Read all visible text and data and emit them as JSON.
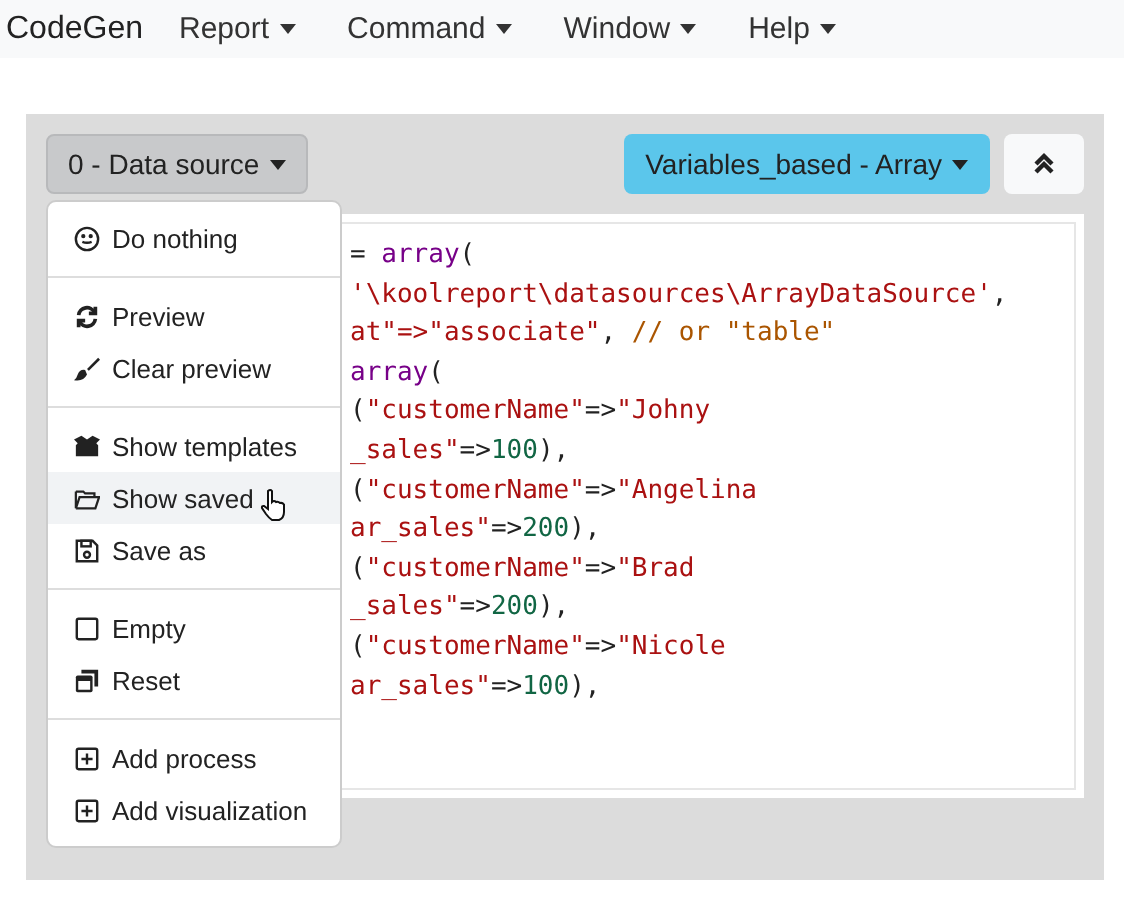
{
  "navbar": {
    "brand": "CodeGen",
    "menus": [
      {
        "label": "Report"
      },
      {
        "label": "Command"
      },
      {
        "label": "Window"
      },
      {
        "label": "Help"
      }
    ]
  },
  "toolbar": {
    "datasource_button": "0 - Data source",
    "variables_button": "Variables_based - Array",
    "collapse_button": {
      "expanded": true
    }
  },
  "menu": {
    "sections": [
      {
        "items": [
          {
            "label": "Do nothing",
            "hovered": false
          }
        ]
      },
      {
        "items": [
          {
            "label": "Preview",
            "hovered": false
          },
          {
            "label": "Clear preview",
            "hovered": false
          }
        ]
      },
      {
        "items": [
          {
            "label": "Show templates",
            "hovered": false
          },
          {
            "label": "Show saved",
            "hovered": true
          },
          {
            "label": "Save as",
            "hovered": false
          }
        ]
      },
      {
        "items": [
          {
            "label": "Empty",
            "hovered": false
          },
          {
            "label": "Reset",
            "hovered": false
          }
        ]
      },
      {
        "items": [
          {
            "label": "Add process",
            "hovered": false
          },
          {
            "label": "Add visualization",
            "hovered": false
          }
        ]
      }
    ]
  },
  "code_lines": [
    [
      {
        "kind": "plain",
        "text": "= "
      },
      {
        "kind": "keyword",
        "text": "array"
      },
      {
        "kind": "plain",
        "text": "("
      }
    ],
    [
      {
        "kind": "string",
        "text": "'\\koolreport\\datasources\\ArrayDataSource'"
      },
      {
        "kind": "plain",
        "text": ","
      }
    ],
    [
      {
        "kind": "string",
        "text": "at\"=>\"associate\""
      },
      {
        "kind": "plain",
        "text": ", "
      },
      {
        "kind": "comment",
        "text": "// or \"table\""
      }
    ],
    [
      {
        "kind": "keyword",
        "text": "array"
      },
      {
        "kind": "plain",
        "text": "("
      }
    ],
    [
      {
        "kind": "plain",
        "text": "("
      },
      {
        "kind": "string",
        "text": "\"customerName\""
      },
      {
        "kind": "plain",
        "text": "=>"
      },
      {
        "kind": "string",
        "text": "\"Johny"
      }
    ],
    [
      {
        "kind": "string",
        "text": "_sales\""
      },
      {
        "kind": "plain",
        "text": "=>"
      },
      {
        "kind": "number",
        "text": "100"
      },
      {
        "kind": "plain",
        "text": "),"
      }
    ],
    [
      {
        "kind": "plain",
        "text": "("
      },
      {
        "kind": "string",
        "text": "\"customerName\""
      },
      {
        "kind": "plain",
        "text": "=>"
      },
      {
        "kind": "string",
        "text": "\"Angelina"
      }
    ],
    [
      {
        "kind": "string",
        "text": "ar_sales\""
      },
      {
        "kind": "plain",
        "text": "=>"
      },
      {
        "kind": "number",
        "text": "200"
      },
      {
        "kind": "plain",
        "text": "),"
      }
    ],
    [
      {
        "kind": "plain",
        "text": "("
      },
      {
        "kind": "string",
        "text": "\"customerName\""
      },
      {
        "kind": "plain",
        "text": "=>"
      },
      {
        "kind": "string",
        "text": "\"Brad"
      }
    ],
    [
      {
        "kind": "string",
        "text": "_sales\""
      },
      {
        "kind": "plain",
        "text": "=>"
      },
      {
        "kind": "number",
        "text": "200"
      },
      {
        "kind": "plain",
        "text": "),"
      }
    ],
    [
      {
        "kind": "plain",
        "text": "("
      },
      {
        "kind": "string",
        "text": "\"customerName\""
      },
      {
        "kind": "plain",
        "text": "=>"
      },
      {
        "kind": "string",
        "text": "\"Nicole"
      }
    ],
    [
      {
        "kind": "string",
        "text": "ar_sales\""
      },
      {
        "kind": "plain",
        "text": "=>"
      },
      {
        "kind": "number",
        "text": "100"
      },
      {
        "kind": "plain",
        "text": "),"
      }
    ]
  ]
}
